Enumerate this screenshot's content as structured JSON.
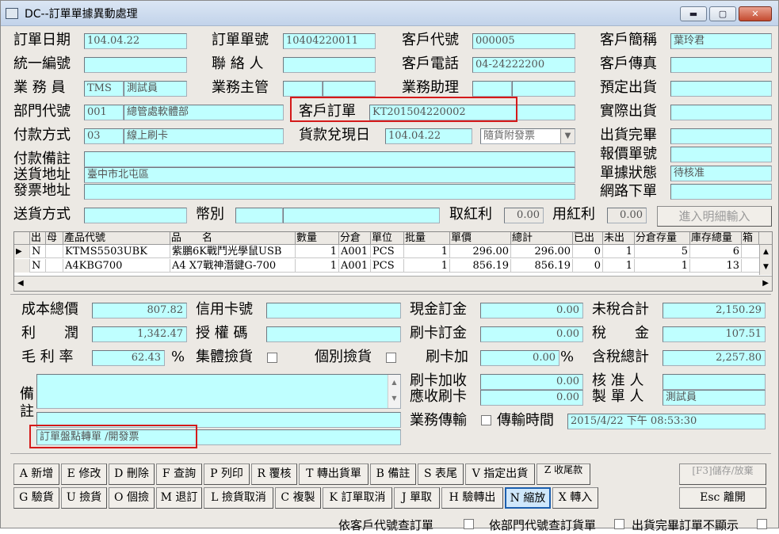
{
  "window": {
    "title": "DC--訂單單據異動處理",
    "min": "▬",
    "max": "▢",
    "close": "✕"
  },
  "header": {
    "order_date_label": "訂單日期",
    "order_date": "104.04.22",
    "order_no_label": "訂單單號",
    "order_no": "10404220011",
    "cust_code_label": "客戶代號",
    "cust_code": "000005",
    "cust_short_label": "客戶簡稱",
    "cust_short": "葉玲君",
    "tax_id_label": "統一編號",
    "tax_id": "",
    "contact_label": "聯 絡 人",
    "contact": "",
    "cust_phone_label": "客戶電話",
    "cust_phone": "04-24222200",
    "cust_fax_label": "客戶傳真",
    "cust_fax": "",
    "sales_label": "業 務 員",
    "sales_code": "TMS",
    "sales_name": "測試員",
    "sales_mgr_label": "業務主管",
    "sales_asst_label": "業務助理",
    "planned_ship_label": "預定出貨",
    "planned_ship": "",
    "dept_label": "部門代號",
    "dept_code": "001",
    "dept_name": "總管處軟體部",
    "cust_order_label": "客戶訂單",
    "cust_order": "KT201504220002",
    "actual_ship_label": "實際出貨",
    "actual_ship": "",
    "pay_label": "付款方式",
    "pay_code": "03",
    "pay_name": "線上刷卡",
    "cash_date_label": "貨款兌現日",
    "cash_date": "104.04.22",
    "invoice_mode": "隨貨附發票",
    "ship_done_label": "出貨完畢",
    "quote_no_label": "報價單號",
    "pay_note_label": "付款備註",
    "ship_addr_label": "送貨地址",
    "ship_addr": "臺中市北屯區",
    "inv_addr_label": "發票地址",
    "status_label": "單據狀態",
    "status": "待核准",
    "web_order_label": "網路下單",
    "ship_method_label": "送貨方式",
    "currency_label": "幣別",
    "take_bonus_label": "取紅利",
    "take_bonus": "0.00",
    "use_bonus_label": "用紅利",
    "use_bonus": "0.00",
    "detail_btn": "進入明細輸入"
  },
  "grid": {
    "columns": [
      "出",
      "母",
      "產品代號",
      "品　　名",
      "數量",
      "分倉",
      "單位",
      "批量",
      "單價",
      "總計",
      "已出",
      "未出",
      "分倉存量",
      "庫存總量",
      "箱"
    ],
    "rows": [
      [
        "N",
        "",
        "KTMS5503UBK",
        "紫鵬6K戰鬥光學鼠USB",
        "1",
        "A001",
        "PCS",
        "1",
        "296.00",
        "296.00",
        "0",
        "1",
        "5",
        "6"
      ],
      [
        "N",
        "",
        "A4KBG700",
        "A4 X7戰神潛鍵G-700",
        "1",
        "A001",
        "PCS",
        "1",
        "856.19",
        "856.19",
        "0",
        "1",
        "1",
        "13"
      ]
    ]
  },
  "summary": {
    "cost_label": "成本總價",
    "cost": "807.82",
    "profit_label": "利　　潤",
    "profit": "1,342.47",
    "margin_label": "毛 利 率",
    "margin": "62.43",
    "pct": "%",
    "card_no_label": "信用卡號",
    "auth_label": "授 權 碼",
    "group_pick_label": "集體撿貨",
    "single_pick_label": "個別撿貨",
    "cash_order_label": "現金訂金",
    "cash_order": "0.00",
    "card_order_label": "刷卡訂金",
    "card_order": "0.00",
    "card_add_label": "刷卡加",
    "card_add": "0.00",
    "card_add_pct": "%",
    "card_fee_label": "刷卡加收",
    "card_fee": "0.00",
    "card_recv_label": "應收刷卡",
    "card_recv": "0.00",
    "untaxed_label": "未稅合計",
    "untaxed": "2,150.29",
    "tax_label": "稅　　金",
    "tax": "107.51",
    "total_label": "含稅總計",
    "total": "2,257.80",
    "approver_label": "核 准 人",
    "approver": "",
    "maker_label": "製 單 人",
    "maker": "測試員",
    "note_label": "備註",
    "note_line": "訂單盤點轉單 /開發票",
    "sales_trans_label": "業務傳輸",
    "trans_time_label": "傳輸時間",
    "trans_time": "2015/4/22 下午 08:53:30"
  },
  "buttons": {
    "row1": [
      "A 新增",
      "E 修改",
      "D 刪除",
      "F 查詢",
      "P 列印",
      "R 覆核",
      "T 轉出貨單",
      "B 備註",
      "S 表尾",
      "V 指定出貨",
      "Z 收尾款"
    ],
    "row2": [
      "G 驗貨",
      "U 撿貨",
      "O 個撿",
      "M 退訂",
      "L 撿貨取消",
      "C 複製",
      "K 訂單取消",
      "J 單取",
      "H 驗轉出",
      "N 縮放",
      "X 轉入"
    ],
    "save": "[F3]儲存/放棄",
    "exit": "Esc 離開"
  },
  "footer": {
    "opt1": "依客戶代號查訂單",
    "opt2": "依部門代號查訂貨單",
    "opt3": "出貨完畢訂單不顯示"
  }
}
